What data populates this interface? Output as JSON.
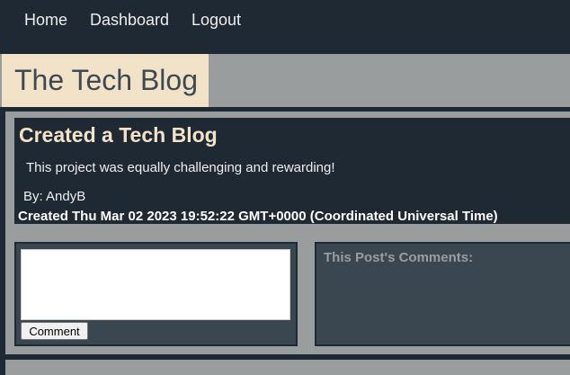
{
  "nav": {
    "home": "Home",
    "dashboard": "Dashboard",
    "logout": "Logout"
  },
  "site": {
    "title": "The Tech Blog"
  },
  "post": {
    "title": "Created a Tech Blog",
    "body": "This project was equally challenging and rewarding!",
    "author": "By: AndyB",
    "created": "Created Thu Mar 02 2023 19:52:22 GMT+0000 (Coordinated Universal Time)"
  },
  "comment_form": {
    "textarea_value": "",
    "button_label": "Comment"
  },
  "comments": {
    "heading": "This Post's Comments:"
  },
  "colors": {
    "dark": "#1f2933",
    "panel": "#3a4750",
    "accent": "#f1e2c8",
    "gray": "#9a9d9e"
  }
}
